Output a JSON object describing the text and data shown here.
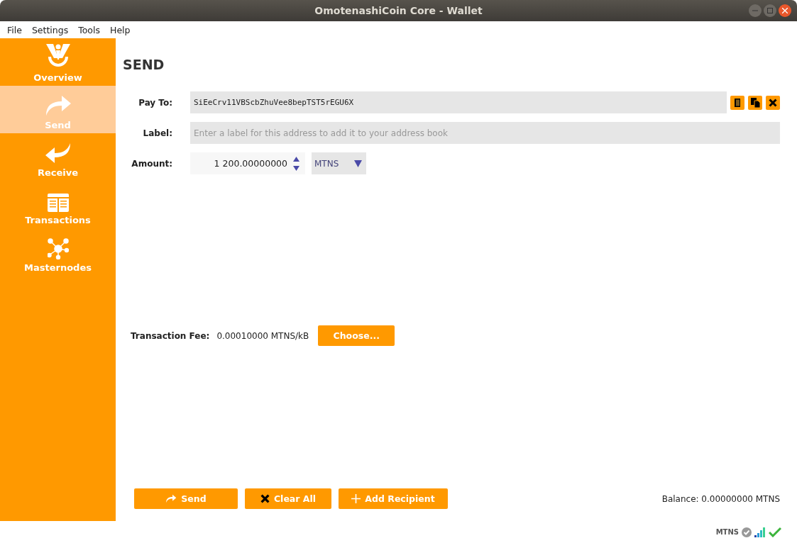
{
  "window": {
    "title": "OmotenashiCoin Core - Wallet"
  },
  "menu": [
    "File",
    "Settings",
    "Tools",
    "Help"
  ],
  "sidebar": {
    "items": [
      {
        "label": "Overview",
        "kind": "logo",
        "selected": false
      },
      {
        "label": "Send",
        "kind": "send",
        "selected": true
      },
      {
        "label": "Receive",
        "kind": "receive",
        "selected": false
      },
      {
        "label": "Transactions",
        "kind": "transactions",
        "selected": false
      },
      {
        "label": "Masternodes",
        "kind": "masternodes",
        "selected": false
      }
    ]
  },
  "page": {
    "heading": "SEND",
    "pay_to": {
      "label": "Pay To:",
      "value": "SiEeCrv11VBScbZhuVee8bepTST5rEGU6X"
    },
    "label_field": {
      "label": "Label:",
      "placeholder": "Enter a label for this address to add it to your address book"
    },
    "amount": {
      "label": "Amount:",
      "value": "1 200.00000000",
      "unit": "MTNS"
    },
    "fee": {
      "label": "Transaction Fee:",
      "value": "0.00010000 MTNS/kB",
      "button": "Choose..."
    },
    "buttons": [
      {
        "label": "Send",
        "kind": "send"
      },
      {
        "label": "Clear All",
        "kind": "clear"
      },
      {
        "label": "Add Recipient",
        "kind": "add"
      }
    ],
    "balance": "Balance: 0.00000000 MTNS"
  },
  "status_bar": {
    "unit": "MTNS"
  }
}
